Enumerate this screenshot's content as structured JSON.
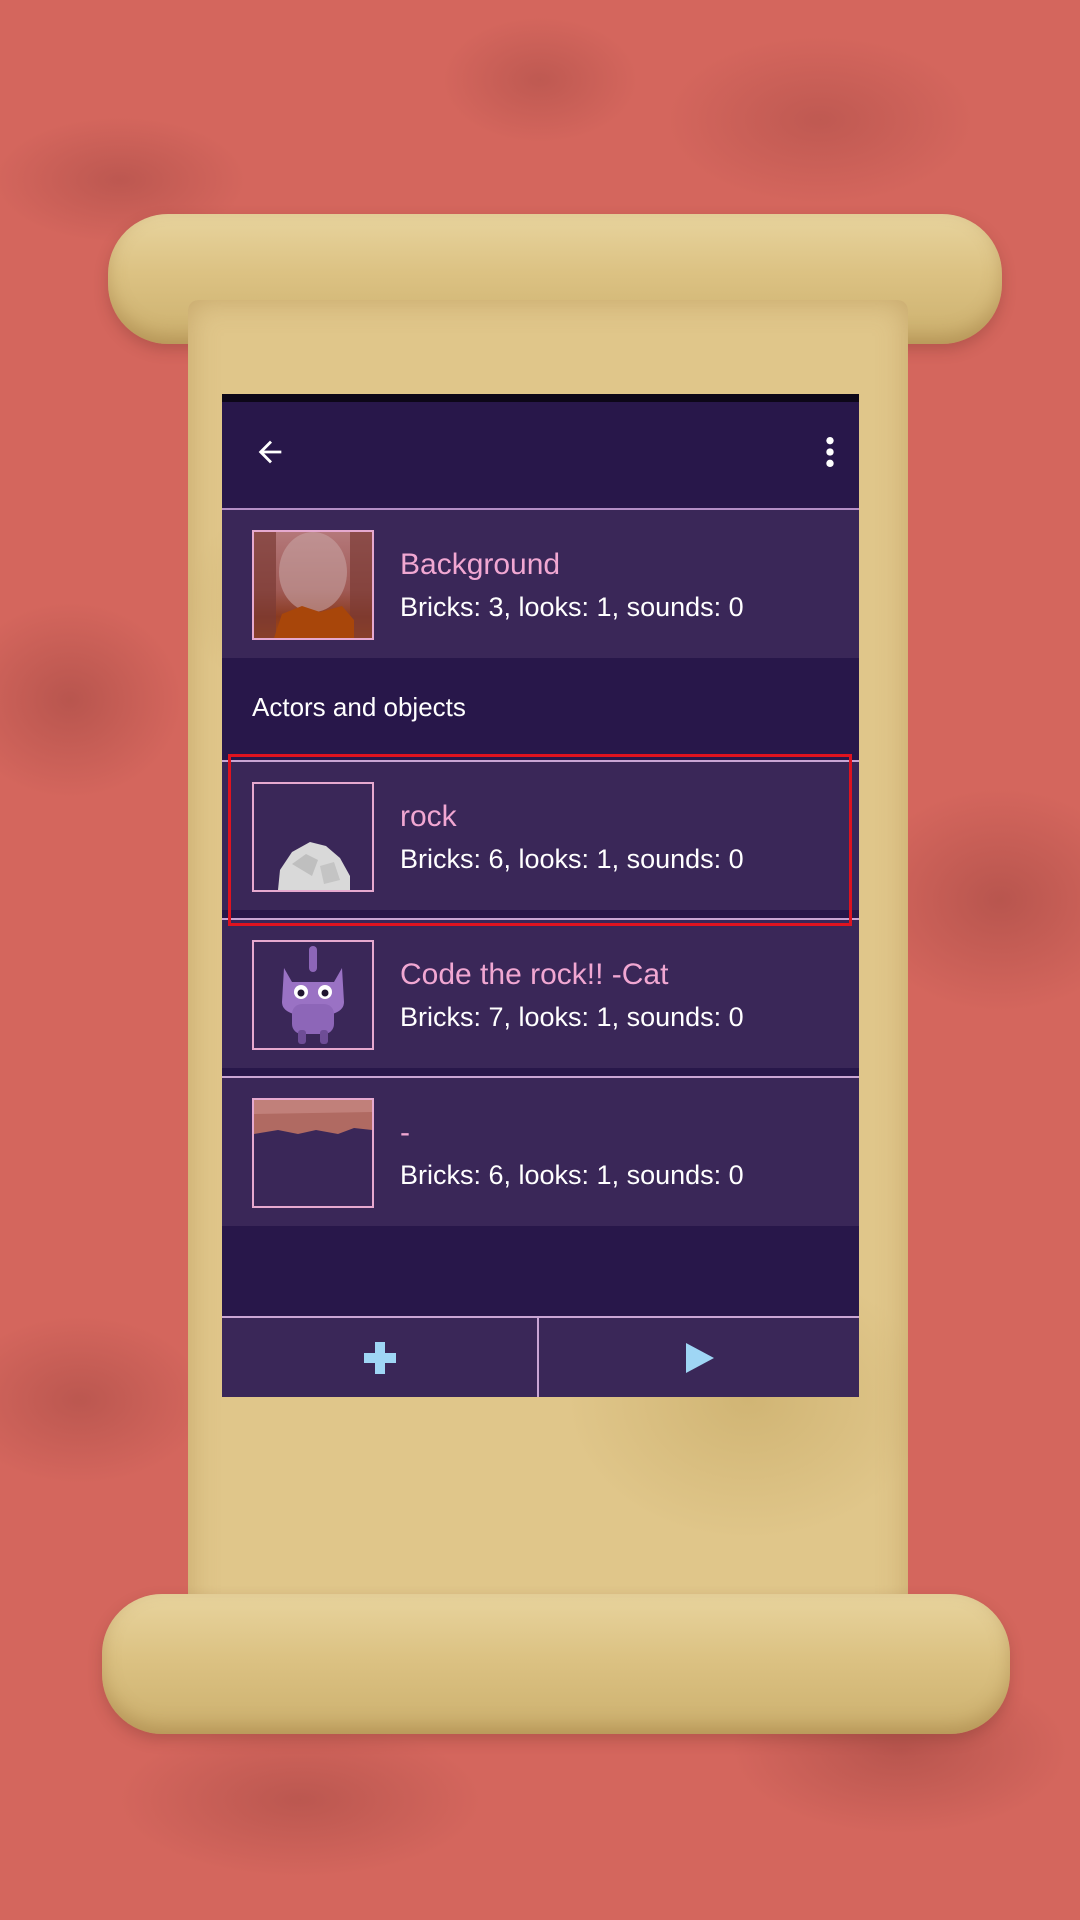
{
  "toolbar": {
    "back_icon": "arrow-left-icon",
    "menu_icon": "more-vertical-icon"
  },
  "background_sprite": {
    "name": "Background",
    "stats": "Bricks: 3, looks: 1, sounds: 0"
  },
  "section": {
    "title": "Actors and objects"
  },
  "sprites": [
    {
      "name": "rock",
      "stats": "Bricks: 6, looks: 1, sounds: 0"
    },
    {
      "name": "Code the rock!! -Cat",
      "stats": "Bricks: 7, looks: 1, sounds: 0"
    },
    {
      "name": "-",
      "stats": "Bricks: 6, looks: 1, sounds: 0"
    }
  ],
  "bottom_bar": {
    "add_icon": "plus-icon",
    "play_icon": "play-icon"
  },
  "colors": {
    "panel_bg": "#28174a",
    "row_bg": "#3a2758",
    "name_pink": "#f1a7d2",
    "accent_blue": "#9fd6f5",
    "highlight_red": "#e0131f"
  }
}
